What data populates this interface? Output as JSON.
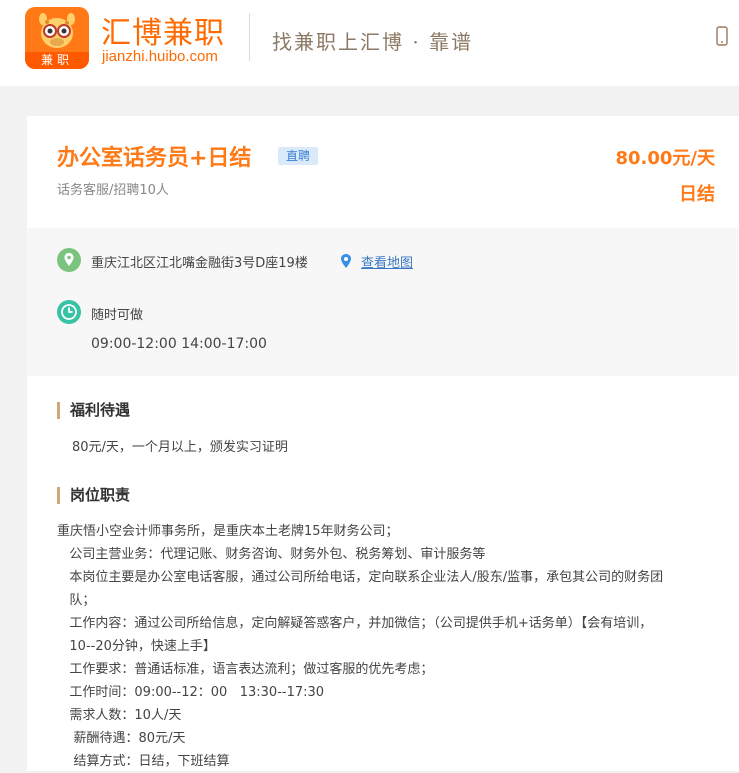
{
  "header": {
    "logo_tag": "兼职",
    "brand_name": "汇博兼职",
    "brand_domain": "jianzhi.huibo.com",
    "slogan": "找兼职上汇博 · 靠谱",
    "phone_icon": "mobile-phone-icon"
  },
  "job": {
    "title": "办公室话务员+日结",
    "badge": "直聘",
    "subtitle": "话务客服/招聘10人",
    "salary": "80.00元/天",
    "pay_cycle": "日结"
  },
  "info": {
    "address": "重庆江北区江北嘴金融街3号D座19楼",
    "map_link": "查看地图",
    "anytime": "随时可做",
    "hours": "09:00-12:00 14:00-17:00"
  },
  "benefits": {
    "title": "福利待遇",
    "text": "80元/天，一个月以上，颁发实习证明"
  },
  "duties": {
    "title": "岗位职责",
    "lines": [
      "重庆悟小空会计师事务所，是重庆本土老牌15年财务公司；",
      "   公司主营业务：代理记账、财务咨询、财务外包、税务筹划、审计服务等",
      "   本岗位主要是办公室电话客服，通过公司所给电话，定向联系企业法人/股东/监事，承包其公司的财务团",
      "   队；",
      "   工作内容：通过公司所给信息，定向解疑答惑客户，并加微信；（公司提供手机+话务单）【会有培训，",
      "   10--20分钟，快速上手】",
      "   工作要求：普通话标准，语言表达流利；做过客服的优先考虑；",
      "   工作时间：09:00--12：00   13:30--17:30",
      "   需求人数：10人/天",
      "    薪酬待遇：80元/天",
      "    结算方式：日结，下班结算"
    ]
  },
  "colors": {
    "accent": "#ff7a17",
    "link": "#3a78c3",
    "badge_bg": "#dbeafa",
    "icon_green": "#7bc47f",
    "icon_teal": "#36c2a3"
  }
}
